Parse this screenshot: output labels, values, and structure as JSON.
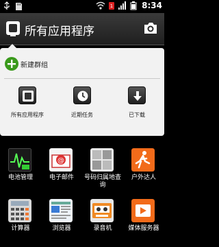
{
  "status_bar": {
    "time": "8:34",
    "icons_left": [
      "usb-icon",
      "sd-card-icon"
    ],
    "icons_right": [
      "wifi-icon",
      "sim-icon",
      "signal-icon",
      "battery-icon"
    ]
  },
  "header": {
    "title": "所有应用程序",
    "app_icon": "app-drawer-icon",
    "action_icon": "camera-icon"
  },
  "popup": {
    "new_group_label": "新建群组",
    "quick_actions": [
      {
        "label": "所有应用程序",
        "icon": "all-apps-icon"
      },
      {
        "label": "近期任务",
        "icon": "clock-icon"
      },
      {
        "label": "已下载",
        "icon": "download-icon"
      }
    ]
  },
  "apps": [
    {
      "name": "电池管理",
      "icon": "battery-manager-icon"
    },
    {
      "name": "电子邮件",
      "icon": "email-icon"
    },
    {
      "name": "号码归属地查询",
      "icon": "phone-lookup-icon"
    },
    {
      "name": "户外达人",
      "icon": "outdoor-icon"
    },
    {
      "name": "计算器",
      "icon": "calculator-icon"
    },
    {
      "name": "浏览器",
      "icon": "browser-icon"
    },
    {
      "name": "录音机",
      "icon": "recorder-icon"
    },
    {
      "name": "媒体服务器",
      "icon": "media-server-icon"
    }
  ],
  "colors": {
    "header_bg": "#2d2d2d",
    "popup_bg": "#f2f2f2",
    "new_group_green": "#3a9a1c"
  }
}
